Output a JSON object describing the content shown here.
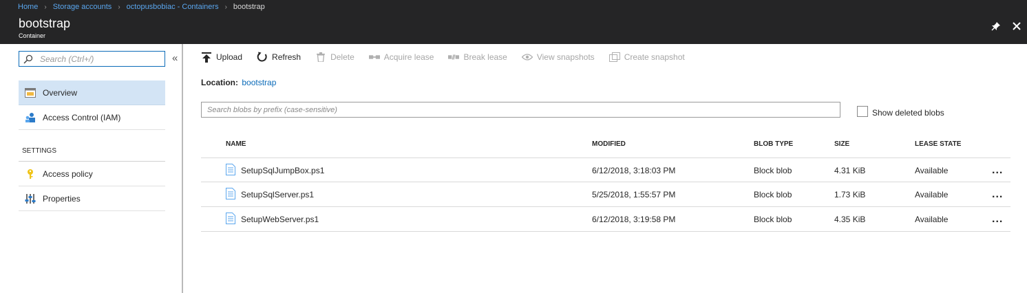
{
  "breadcrumb": [
    {
      "label": "Home"
    },
    {
      "label": "Storage accounts"
    },
    {
      "label": "octopusbobiac - Containers"
    }
  ],
  "breadcrumb_current": "bootstrap",
  "header": {
    "title": "bootstrap",
    "subtitle": "Container"
  },
  "left_nav": {
    "search_placeholder": "Search (Ctrl+/)",
    "items": [
      {
        "label": "Overview",
        "icon": "overview-icon"
      },
      {
        "label": "Access Control (IAM)",
        "icon": "iam-icon"
      }
    ],
    "section_title": "SETTINGS",
    "settings_items": [
      {
        "label": "Access policy",
        "icon": "key-icon"
      },
      {
        "label": "Properties",
        "icon": "properties-icon"
      }
    ]
  },
  "toolbar": {
    "upload": "Upload",
    "refresh": "Refresh",
    "delete": "Delete",
    "acquire_lease": "Acquire lease",
    "break_lease": "Break lease",
    "view_snapshots": "View snapshots",
    "create_snapshot": "Create snapshot"
  },
  "location": {
    "label": "Location:",
    "value": "bootstrap"
  },
  "blob_search": {
    "placeholder": "Search blobs by prefix (case-sensitive)"
  },
  "show_deleted": {
    "label": "Show deleted blobs",
    "checked": false
  },
  "table": {
    "headers": {
      "name": "NAME",
      "modified": "MODIFIED",
      "blob_type": "BLOB TYPE",
      "size": "SIZE",
      "lease_state": "LEASE STATE"
    },
    "rows": [
      {
        "name": "SetupSqlJumpBox.ps1",
        "modified": "6/12/2018, 3:18:03 PM",
        "blob_type": "Block blob",
        "size": "4.31 KiB",
        "lease_state": "Available"
      },
      {
        "name": "SetupSqlServer.ps1",
        "modified": "5/25/2018, 1:55:57 PM",
        "blob_type": "Block blob",
        "size": "1.73 KiB",
        "lease_state": "Available"
      },
      {
        "name": "SetupWebServer.ps1",
        "modified": "6/12/2018, 3:19:58 PM",
        "blob_type": "Block blob",
        "size": "4.35 KiB",
        "lease_state": "Available"
      }
    ],
    "more_label": "..."
  },
  "colors": {
    "header_bg": "#252526",
    "link": "#0a6ab8",
    "selected": "#d3e4f5"
  }
}
